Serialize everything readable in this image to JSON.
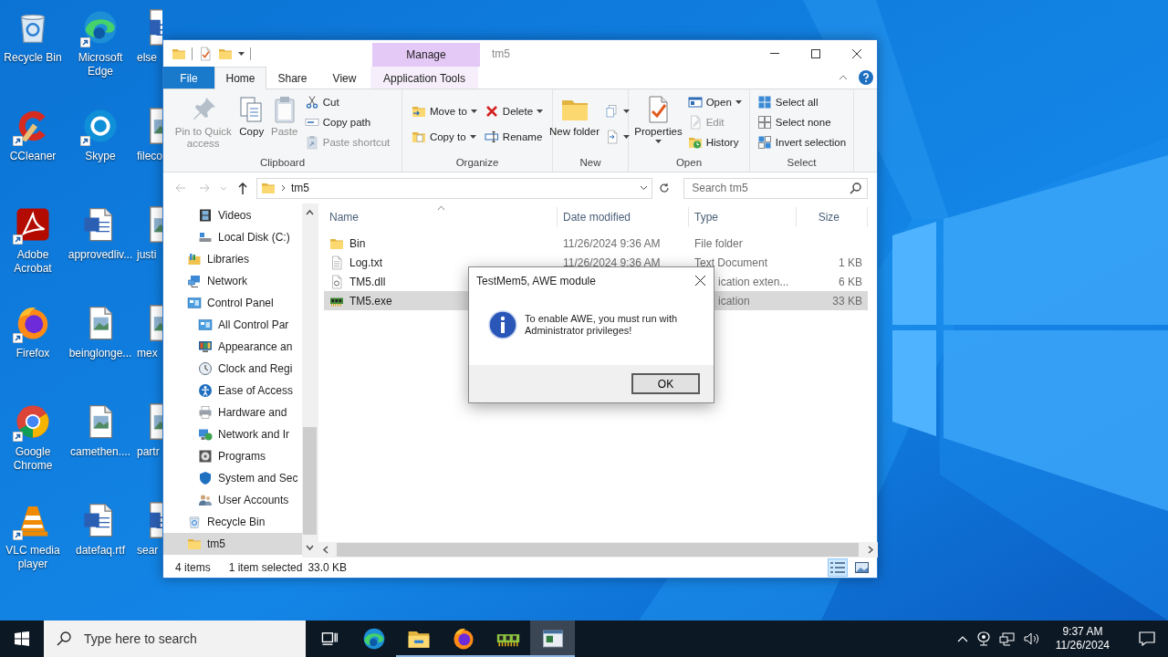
{
  "desktop": {
    "icon_columns": [
      {
        "icons": [
          {
            "label": "Recycle Bin",
            "kind": "recycle",
            "shortcut": false
          },
          {
            "label": "CCleaner",
            "kind": "ccleaner",
            "shortcut": true
          },
          {
            "label": "Adobe Acrobat",
            "kind": "acrobat",
            "shortcut": true
          },
          {
            "label": "Firefox",
            "kind": "firefox",
            "shortcut": true
          },
          {
            "label": "Google Chrome",
            "kind": "chrome",
            "shortcut": true
          },
          {
            "label": "VLC media player",
            "kind": "vlc",
            "shortcut": true
          }
        ]
      },
      {
        "icons": [
          {
            "label": "Microsoft Edge",
            "kind": "edge",
            "shortcut": true
          },
          {
            "label": "Skype",
            "kind": "skype",
            "shortcut": true
          },
          {
            "label": "approvedliv...",
            "kind": "worddoc",
            "shortcut": false
          },
          {
            "label": "beinglonge...",
            "kind": "imagedoc",
            "shortcut": false
          },
          {
            "label": "camethen....",
            "kind": "imagedoc",
            "shortcut": false
          },
          {
            "label": "datefaq.rtf",
            "kind": "worddoc",
            "shortcut": false
          }
        ]
      },
      {
        "icons": [
          {
            "label": "else",
            "kind": "worddoc",
            "shortcut": false
          },
          {
            "label": "fileco",
            "kind": "imagedoc",
            "shortcut": false
          },
          {
            "label": "justi",
            "kind": "imagedoc",
            "shortcut": false
          },
          {
            "label": "mex",
            "kind": "imagedoc",
            "shortcut": false
          },
          {
            "label": "partr",
            "kind": "imagedoc",
            "shortcut": false
          },
          {
            "label": "sear",
            "kind": "worddoc",
            "shortcut": false
          }
        ]
      }
    ]
  },
  "explorer": {
    "title": "tm5",
    "context_header": "Manage",
    "tabs": [
      {
        "label": "File",
        "kind": "file",
        "selected": false
      },
      {
        "label": "Home",
        "kind": "tab",
        "selected": true
      },
      {
        "label": "Share",
        "kind": "tab",
        "selected": false
      },
      {
        "label": "View",
        "kind": "tab",
        "selected": false
      },
      {
        "label": "Application Tools",
        "kind": "context",
        "selected": false
      }
    ],
    "ribbon_groups": [
      {
        "label": "Clipboard",
        "large": [
          {
            "label": "Pin to Quick access",
            "kind": "pin",
            "disabled": true,
            "dropdown": false
          },
          {
            "label": "Copy",
            "kind": "copy",
            "disabled": false,
            "dropdown": false
          },
          {
            "label": "Paste",
            "kind": "paste",
            "disabled": true,
            "dropdown": false
          }
        ],
        "small": [
          {
            "label": "Cut",
            "kind": "cut",
            "disabled": false,
            "dropdown": false
          },
          {
            "label": "Copy path",
            "kind": "copypath",
            "disabled": false,
            "dropdown": false
          },
          {
            "label": "Paste shortcut",
            "kind": "pasteshortcut",
            "disabled": true,
            "dropdown": false
          }
        ]
      },
      {
        "label": "Organize",
        "small": [
          {
            "label": "Move to",
            "kind": "moveto",
            "disabled": false,
            "dropdown": true
          },
          {
            "label": "Copy to",
            "kind": "copyto",
            "disabled": false,
            "dropdown": true
          },
          {
            "label": "Delete",
            "kind": "delete",
            "disabled": false,
            "dropdown": true
          },
          {
            "label": "Rename",
            "kind": "rename",
            "disabled": false,
            "dropdown": false
          }
        ]
      },
      {
        "label": "New",
        "large": [
          {
            "label": "New folder",
            "kind": "newfolder",
            "disabled": false,
            "dropdown": false
          }
        ],
        "small": [
          {
            "kind": "newitem",
            "disabled": false,
            "dropdown": true
          },
          {
            "kind": "easyaccess",
            "disabled": false,
            "dropdown": true
          }
        ]
      },
      {
        "label": "Open",
        "large": [
          {
            "label": "Properties",
            "kind": "properties",
            "disabled": false,
            "dropdown": true
          }
        ],
        "small": [
          {
            "label": "Open",
            "kind": "open",
            "disabled": false,
            "dropdown": true
          },
          {
            "label": "Edit",
            "kind": "edit",
            "disabled": true,
            "dropdown": false
          },
          {
            "label": "History",
            "kind": "history",
            "disabled": false,
            "dropdown": false
          }
        ]
      },
      {
        "label": "Select",
        "small": [
          {
            "label": "Select all",
            "kind": "selectall",
            "disabled": false,
            "dropdown": false
          },
          {
            "label": "Select none",
            "kind": "selectnone",
            "disabled": false,
            "dropdown": false
          },
          {
            "label": "Invert selection",
            "kind": "invert",
            "disabled": false,
            "dropdown": false
          }
        ]
      }
    ],
    "address": {
      "path": "tm5"
    },
    "search": {
      "placeholder": "Search tm5"
    },
    "nav": [
      {
        "children": [
          {
            "label": "Videos",
            "kind": "videos",
            "selected": false
          },
          {
            "label": "Local Disk (C:)",
            "kind": "drive",
            "selected": false
          }
        ]
      },
      {
        "label": "Libraries",
        "kind": "libraries",
        "selected": false
      },
      {
        "label": "Network",
        "kind": "network",
        "selected": false
      },
      {
        "label": "Control Panel",
        "kind": "panel",
        "selected": false,
        "children": [
          {
            "label": "All Control Par",
            "kind": "panel",
            "selected": false
          },
          {
            "label": "Appearance an",
            "kind": "appearance",
            "selected": false
          },
          {
            "label": "Clock and Regi",
            "kind": "clock",
            "selected": false
          },
          {
            "label": "Ease of Access",
            "kind": "ease",
            "selected": false
          },
          {
            "label": "Hardware and",
            "kind": "hardware",
            "selected": false
          },
          {
            "label": "Network and Ir",
            "kind": "netinternet",
            "selected": false
          },
          {
            "label": "Programs",
            "kind": "programs",
            "selected": false
          },
          {
            "label": "System and Sec",
            "kind": "system",
            "selected": false
          },
          {
            "label": "User Accounts",
            "kind": "users",
            "selected": false
          }
        ]
      },
      {
        "label": "Recycle Bin",
        "kind": "recycle",
        "selected": false
      },
      {
        "label": "tm5",
        "kind": "folder",
        "selected": true
      }
    ],
    "columns": [
      "Name",
      "Date modified",
      "Type",
      "Size"
    ],
    "files": [
      {
        "name": "Bin",
        "kind": "folder",
        "date": "11/26/2024 9:36 AM",
        "type": "File folder",
        "selected": false
      },
      {
        "name": "Log.txt",
        "kind": "text",
        "date": "11/26/2024 9:36 AM",
        "type": "Text Document",
        "size": "1 KB",
        "selected": false
      },
      {
        "name": "TM5.dll",
        "kind": "dll",
        "type": "ication exten...",
        "size": "6 KB",
        "selected": false
      },
      {
        "name": "TM5.exe",
        "kind": "exe",
        "type": "ication",
        "size": "33 KB",
        "selected": true
      }
    ],
    "status": {
      "count": "4 items",
      "selection": "1 item selected",
      "selection_size": "33.0 KB"
    }
  },
  "dialog": {
    "title": "TestMem5, AWE module",
    "message": "To enable AWE, you must run with Administrator privileges!",
    "button": "OK"
  },
  "taskbar": {
    "search_placeholder": "Type here to search",
    "apps": [
      {
        "kind": "taskview",
        "running": false,
        "active": false
      },
      {
        "kind": "edge",
        "running": false,
        "active": false
      },
      {
        "kind": "explorer",
        "running": true,
        "active": false
      },
      {
        "kind": "firefox",
        "running": true,
        "active": false
      },
      {
        "kind": "memory",
        "running": true,
        "active": false
      },
      {
        "kind": "window",
        "running": true,
        "active": true
      }
    ],
    "time": "9:37 AM",
    "date": "11/26/2024"
  }
}
